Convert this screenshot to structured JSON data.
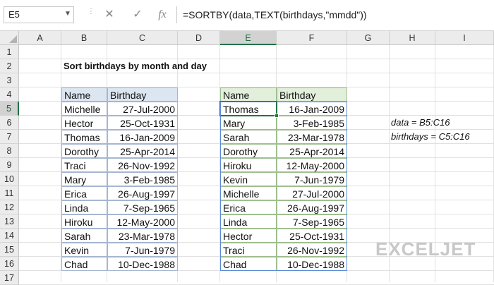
{
  "name_box": "E5",
  "formula": "=SORTBY(data,TEXT(birthdays,\"mmdd\"))",
  "toolbar": {
    "cancel_glyph": "✕",
    "enter_glyph": "✓",
    "fx_label": "fx"
  },
  "columns": [
    "A",
    "B",
    "C",
    "D",
    "E",
    "F",
    "G",
    "H",
    "I"
  ],
  "rows": [
    "1",
    "2",
    "3",
    "4",
    "5",
    "6",
    "7",
    "8",
    "9",
    "10",
    "11",
    "12",
    "13",
    "14",
    "15",
    "16",
    "17"
  ],
  "title": "Sort birthdays by month and day",
  "source_table": {
    "headers": [
      "Name",
      "Birthday"
    ],
    "rows": [
      [
        "Michelle",
        "27-Jul-2000"
      ],
      [
        "Hector",
        "25-Oct-1931"
      ],
      [
        "Thomas",
        "16-Jan-2009"
      ],
      [
        "Dorothy",
        "25-Apr-2014"
      ],
      [
        "Traci",
        "26-Nov-1992"
      ],
      [
        "Mary",
        "3-Feb-1985"
      ],
      [
        "Erica",
        "26-Aug-1997"
      ],
      [
        "Linda",
        "7-Sep-1965"
      ],
      [
        "Hiroku",
        "12-May-2000"
      ],
      [
        "Sarah",
        "23-Mar-1978"
      ],
      [
        "Kevin",
        "7-Jun-1979"
      ],
      [
        "Chad",
        "10-Dec-1988"
      ]
    ]
  },
  "result_table": {
    "headers": [
      "Name",
      "Birthday"
    ],
    "rows": [
      [
        "Thomas",
        "16-Jan-2009"
      ],
      [
        "Mary",
        "3-Feb-1985"
      ],
      [
        "Sarah",
        "23-Mar-1978"
      ],
      [
        "Dorothy",
        "25-Apr-2014"
      ],
      [
        "Hiroku",
        "12-May-2000"
      ],
      [
        "Kevin",
        "7-Jun-1979"
      ],
      [
        "Michelle",
        "27-Jul-2000"
      ],
      [
        "Erica",
        "26-Aug-1997"
      ],
      [
        "Linda",
        "7-Sep-1965"
      ],
      [
        "Hector",
        "25-Oct-1931"
      ],
      [
        "Traci",
        "26-Nov-1992"
      ],
      [
        "Chad",
        "10-Dec-1988"
      ]
    ]
  },
  "notes": [
    "data = B5:C16",
    "birthdays = C5:C16"
  ],
  "logo": "EXCELJET",
  "colors": {
    "accent": "#217346",
    "source_header": "#dce6f1",
    "result_header": "#e2efda"
  }
}
